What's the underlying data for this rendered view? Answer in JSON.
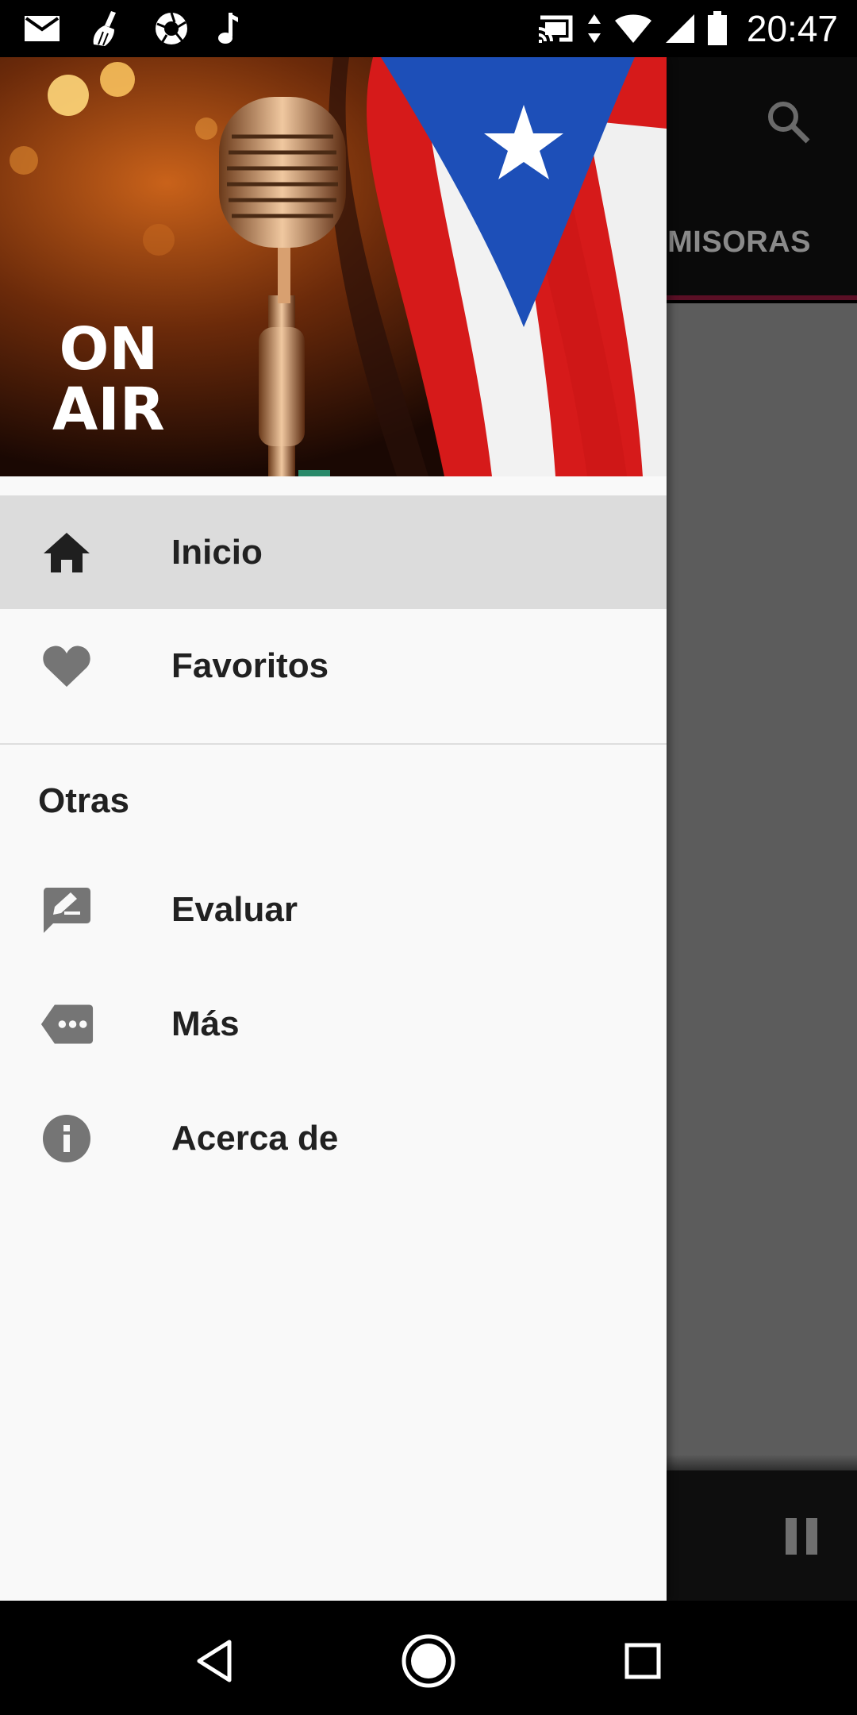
{
  "status_bar": {
    "time": "20:47",
    "left_icons": [
      "mail-icon",
      "broom-icon",
      "aperture-icon",
      "music-note-icon"
    ],
    "right_icons": [
      "cast-icon",
      "data-arrows-icon",
      "wifi-icon",
      "signal-icon",
      "battery-icon"
    ]
  },
  "app": {
    "tab_label": "EMISORAS",
    "accent_color": "#5a0f25"
  },
  "drawer": {
    "header": {
      "badge_line1": "ON",
      "badge_line2": "AIR"
    },
    "items": [
      {
        "label": "Inicio",
        "icon": "home-icon",
        "selected": true
      },
      {
        "label": "Favoritos",
        "icon": "heart-icon",
        "selected": false
      }
    ],
    "section_title": "Otras",
    "other_items": [
      {
        "label": "Evaluar",
        "icon": "rate-review-icon"
      },
      {
        "label": "Más",
        "icon": "more-tag-icon"
      },
      {
        "label": "Acerca de",
        "icon": "info-icon"
      }
    ]
  },
  "nav_bar": {
    "buttons": [
      "back-icon",
      "home-circle-icon",
      "recents-icon"
    ]
  }
}
